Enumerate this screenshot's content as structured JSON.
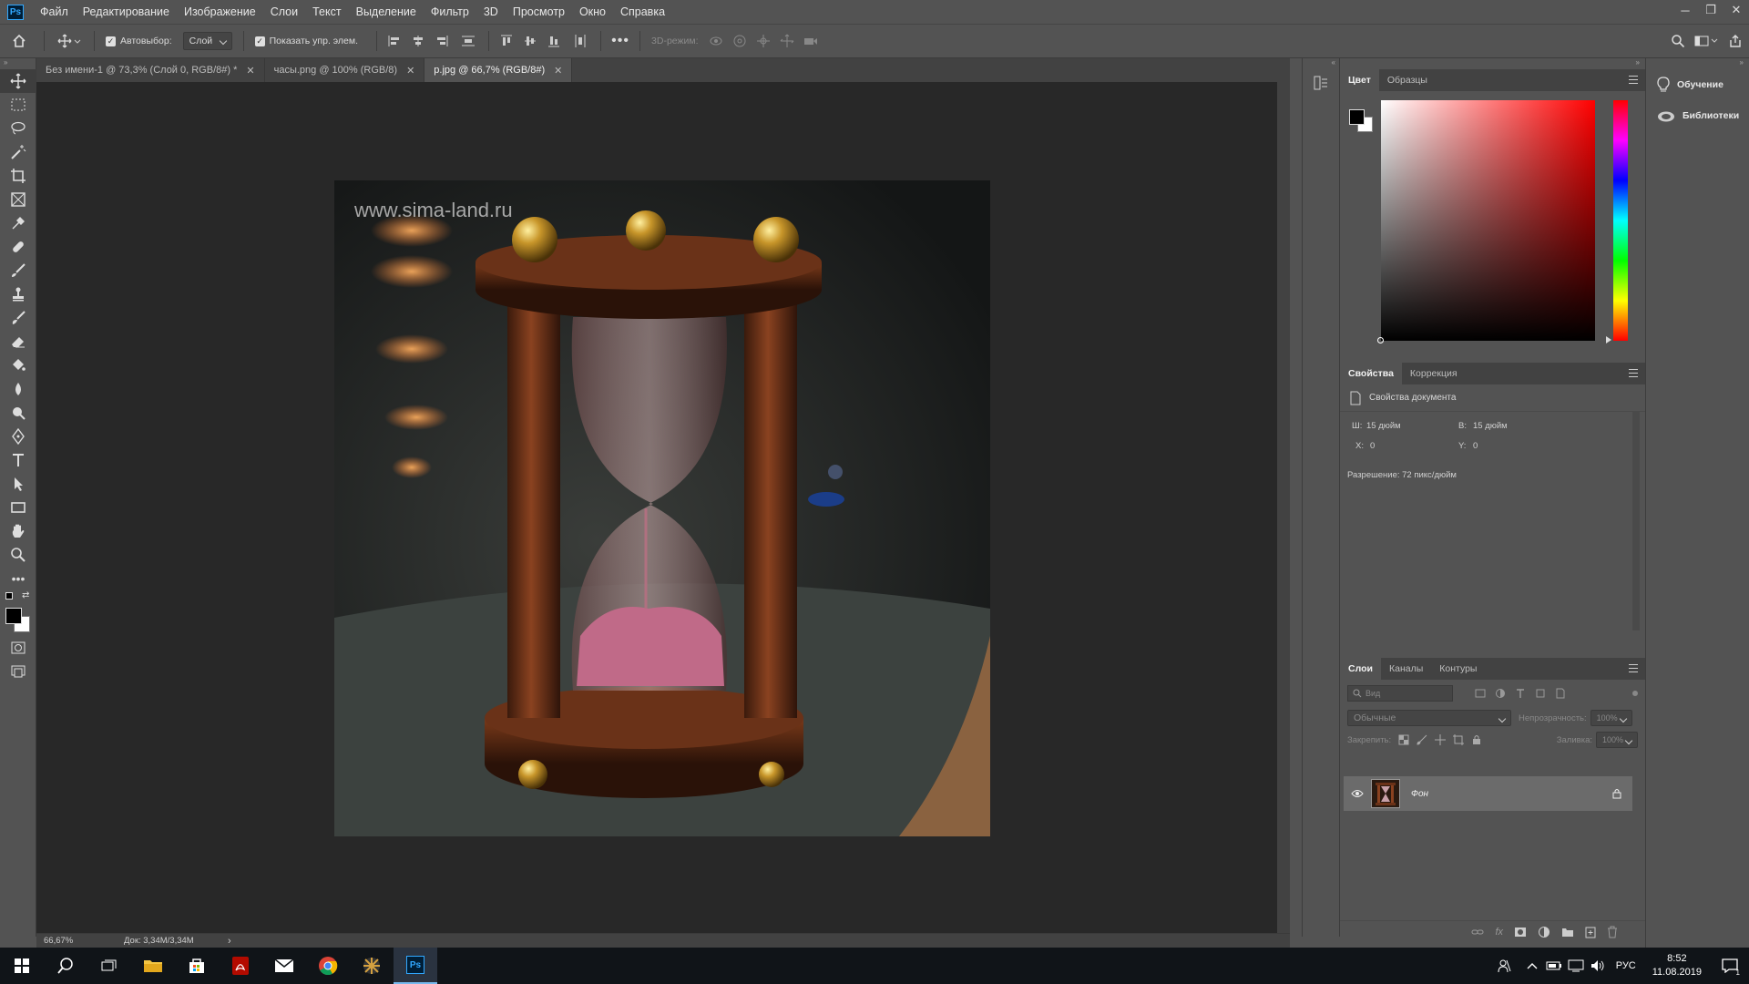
{
  "app": {
    "logo": "Ps"
  },
  "menu": [
    "Файл",
    "Редактирование",
    "Изображение",
    "Слои",
    "Текст",
    "Выделение",
    "Фильтр",
    "3D",
    "Просмотр",
    "Окно",
    "Справка"
  ],
  "options": {
    "autoselect_label": "Автовыбор:",
    "autoselect_value": "Слой",
    "show_transform_label": "Показать упр. элем.",
    "mode3d_label": "3D-режим:"
  },
  "tabs": [
    {
      "label": "Без имени-1 @ 73,3% (Слой 0, RGB/8#) *",
      "active": false
    },
    {
      "label": "часы.png @ 100% (RGB/8)",
      "active": false
    },
    {
      "label": "p.jpg @ 66,7% (RGB/8#)",
      "active": true
    }
  ],
  "canvas": {
    "watermark": "www.sima-land.ru"
  },
  "status": {
    "zoom": "66,67%",
    "doc": "Док: 3,34M/3,34M"
  },
  "color_panel": {
    "tabs": [
      "Цвет",
      "Образцы"
    ],
    "foreground": "#000000",
    "background": "#ffffff",
    "hue": "#ff0000"
  },
  "properties_panel": {
    "tabs": [
      "Свойства",
      "Коррекция"
    ],
    "title": "Свойства документа",
    "width_label": "Ш:",
    "width_value": "15 дюйм",
    "height_label": "В:",
    "height_value": "15 дюйм",
    "x_label": "X:",
    "x_value": "0",
    "y_label": "Y:",
    "y_value": "0",
    "resolution": "Разрешение: 72 пикс/дюйм"
  },
  "layers_panel": {
    "tabs": [
      "Слои",
      "Каналы",
      "Контуры"
    ],
    "search_placeholder": "Вид",
    "blend_mode": "Обычные",
    "opacity_label": "Непрозрачность:",
    "opacity_value": "100%",
    "lock_label": "Закрепить:",
    "fill_label": "Заливка:",
    "fill_value": "100%",
    "layers": [
      {
        "name": "Фон",
        "visible": true,
        "locked": true
      }
    ]
  },
  "libraries": [
    {
      "label": "Обучение",
      "icon": "lightbulb-icon"
    },
    {
      "label": "Библиотеки",
      "icon": "cloud-icon"
    }
  ],
  "taskbar": {
    "lang": "РУС",
    "time": "8:52",
    "date": "11.08.2019",
    "notifications": "1"
  }
}
